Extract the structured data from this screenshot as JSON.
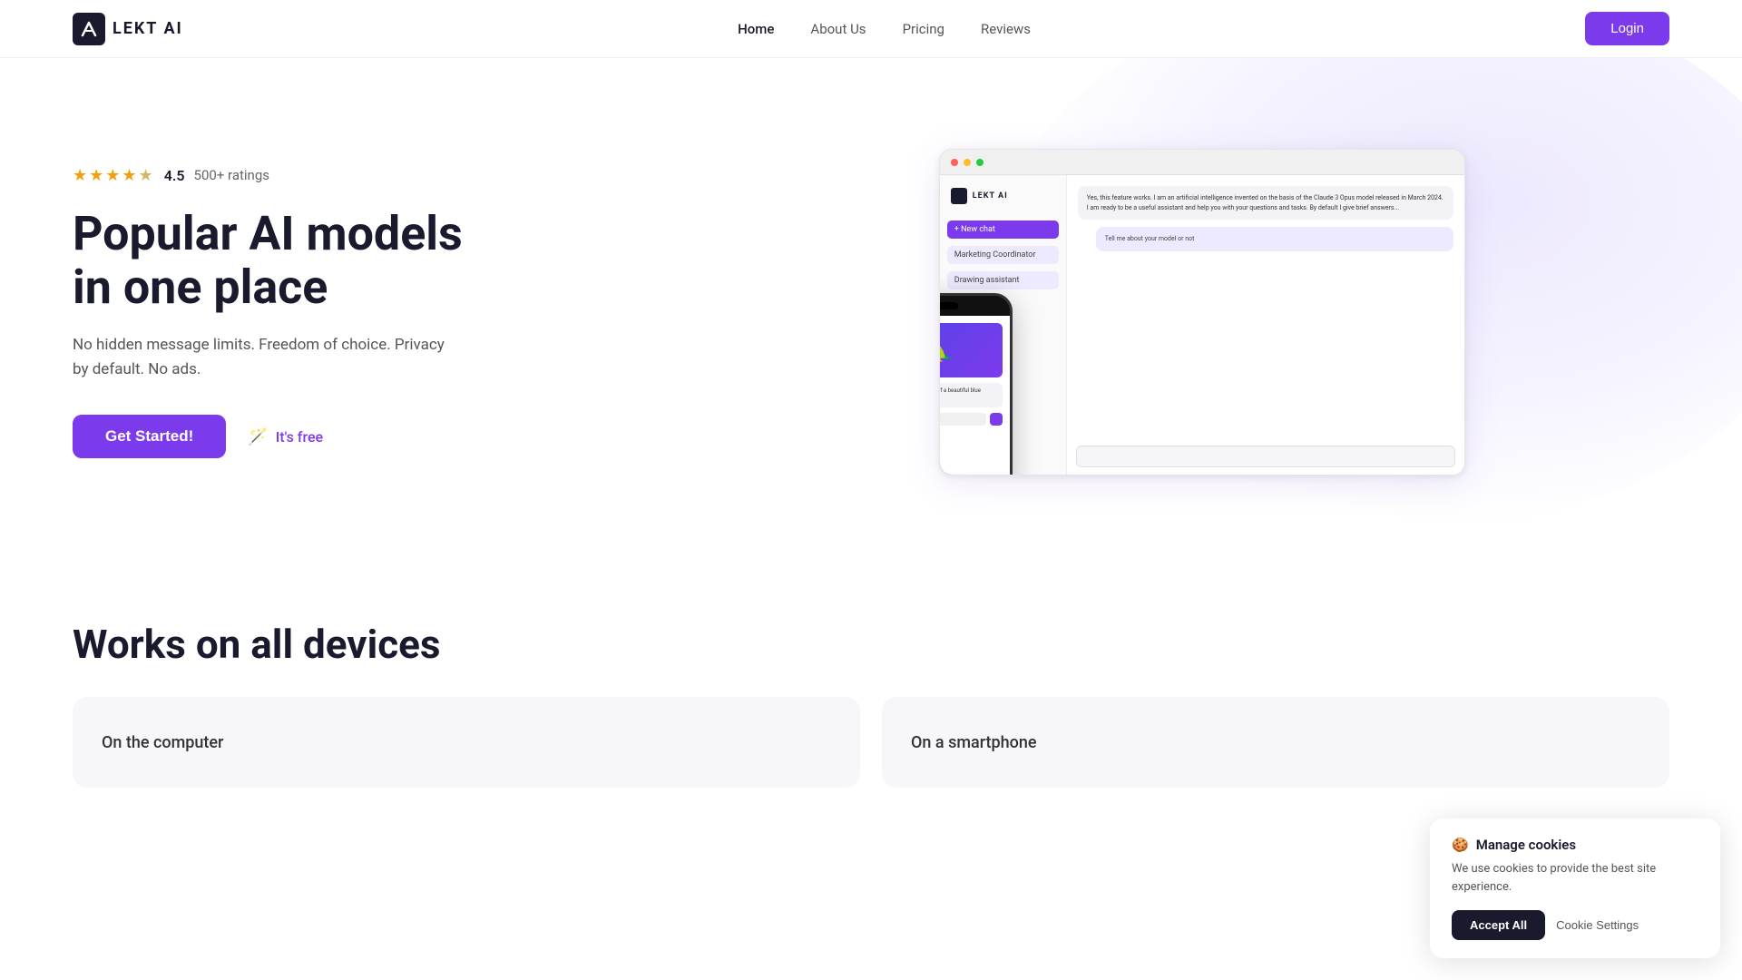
{
  "nav": {
    "logo_text": "LEKT AI",
    "links": [
      {
        "label": "Home",
        "active": true
      },
      {
        "label": "About Us",
        "active": false
      },
      {
        "label": "Pricing",
        "active": false
      },
      {
        "label": "Reviews",
        "active": false
      }
    ],
    "login_label": "Login"
  },
  "hero": {
    "rating_stars": "★★★★★",
    "rating_score": "4.5",
    "rating_count": "500+ ratings",
    "heading_line1": "Popular AI models",
    "heading_line2": "in one place",
    "subtext": "No hidden message limits. Freedom of choice. Privacy by default. No ads.",
    "cta_label": "Get Started!",
    "free_label": "It's free",
    "magic_icon": "🪄"
  },
  "device_section": {
    "heading": "Works on all devices",
    "card1_label": "On the computer",
    "card2_label": "On a smartphone"
  },
  "cookie": {
    "icon": "🍪",
    "title": "Manage cookies",
    "text": "We use cookies to provide the best site experience.",
    "accept_label": "Accept All",
    "settings_label": "Cookie Settings"
  },
  "sidebar_items": [
    {
      "label": "New chat",
      "active": false
    },
    {
      "label": "Marketing Coordinator",
      "active": false
    },
    {
      "label": "Drawing assistant",
      "active": false
    }
  ],
  "chat_bubbles": [
    {
      "text": "Yes, this feature works. I am an artificial intelligence invented on the basis of the Claude 3 Opus model released in March 2024. I am ready to be a useful assistant and help you with your questions and tasks. By default I give brief answers...",
      "user": false
    },
    {
      "text": "Tell me about your model or not",
      "user": true
    }
  ],
  "mobile_chat": [
    {
      "text": "Sure! Here's an image of a beautiful blue parrot..."
    }
  ]
}
